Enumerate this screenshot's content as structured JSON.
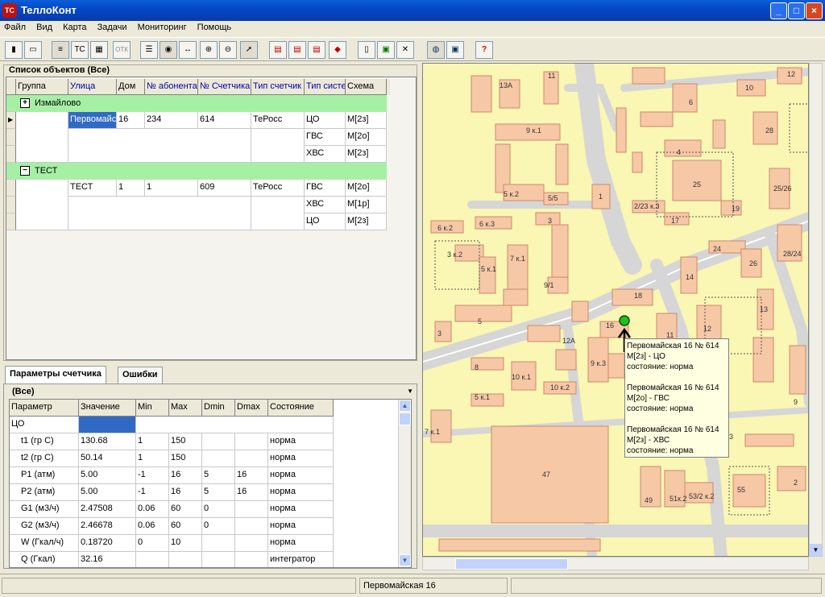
{
  "window": {
    "title": "ТеллоКонт",
    "icon_text": "TC"
  },
  "menu": [
    "Файл",
    "Вид",
    "Карта",
    "Задачи",
    "Мониторинг",
    "Помощь"
  ],
  "toolbar": {
    "otk_label": "ОТК",
    "help_label": "?"
  },
  "objects": {
    "title": "Список объектов (Все)",
    "columns": [
      "Группа",
      "Улица",
      "Дом",
      "№ абонента",
      "№ Счетчика",
      "Тип счетчик",
      "Тип систе",
      "Схема"
    ],
    "group1": {
      "name": "Измайлово",
      "expander": "+"
    },
    "group2": {
      "name": "ТЕСТ",
      "expander": "−"
    },
    "rows": [
      {
        "street": "Первомайская",
        "house": "16",
        "abonent": "234",
        "meter": "614",
        "meter_type": "ТеРосс",
        "system": "ЦО",
        "scheme": "М[2з]"
      },
      {
        "system": "ГВС",
        "scheme": "М[2о]"
      },
      {
        "system": "ХВС",
        "scheme": "М[2з]"
      },
      {
        "street": "ТЕСТ",
        "house": "1",
        "abonent": "1",
        "meter": "609",
        "meter_type": "ТеРосс",
        "system": "ГВС",
        "scheme": "М[2о]"
      },
      {
        "system": "ХВС",
        "scheme": "М[1р]"
      },
      {
        "system": "ЦО",
        "scheme": "М[2з]"
      }
    ]
  },
  "tabs": [
    "Параметры счетчика",
    "Ошибки"
  ],
  "params": {
    "title": "(Все)",
    "columns": [
      "Параметр",
      "Значение",
      "Min",
      "Max",
      "Dmin",
      "Dmax",
      "Состояние"
    ],
    "section": "ЦО",
    "rows": [
      [
        "t1   (гр С)",
        "130.68",
        "1",
        "150",
        "",
        "",
        "норма"
      ],
      [
        "t2   (гр С)",
        "50.14",
        "1",
        "150",
        "",
        "",
        "норма"
      ],
      [
        "P1 (атм)",
        "5.00",
        "-1",
        "16",
        "5",
        "16",
        "норма"
      ],
      [
        "P2 (атм)",
        "5.00",
        "-1",
        "16",
        "5",
        "16",
        "норма"
      ],
      [
        "G1 (м3/ч)",
        "2.47508",
        "0.06",
        "60",
        "0",
        "",
        "норма"
      ],
      [
        "G2 (м3/ч)",
        "2.46678",
        "0.06",
        "60",
        "0",
        "",
        "норма"
      ],
      [
        "W  (Гкал/ч)",
        "0.18720",
        "0",
        "10",
        "",
        "",
        "норма"
      ],
      [
        "Q  (Гкал)",
        "32.16",
        "",
        "",
        "",
        "",
        "интегратор"
      ]
    ]
  },
  "map": {
    "popup": [
      {
        "line1": "Первомайская 16 № 614",
        "line2": "М[2з] - ЦО",
        "line3": "состояние: норма"
      },
      {
        "line1": "Первомайская 16 № 614",
        "line2": "М[2о] - ГВС",
        "line3": "состояние: норма"
      },
      {
        "line1": "Первомайская 16 № 614",
        "line2": "М[2з] - ХВС",
        "line3": "состояние: норма"
      }
    ],
    "labels": [
      "13А",
      "11",
      "10",
      "12",
      "6",
      "28",
      "9 к.1",
      "4",
      "25",
      "25/26",
      "5 к.2",
      "5/5",
      "1",
      "2/23 к.3",
      "19",
      "17",
      "6 к.2",
      "6 к.3",
      "3",
      "3 к.2",
      "5 к.1",
      "7 к.1",
      "24",
      "26",
      "28/24",
      "14",
      "9/1",
      "18",
      "16",
      "13",
      "12",
      "5",
      "12А",
      "11",
      "3",
      "8",
      "10 к.1",
      "9 к.3",
      "10 к.2",
      "5 к.1",
      "7 к.1",
      "47",
      "49",
      "51к.2",
      "53/2 к.2",
      "55",
      "2",
      "3",
      "9"
    ]
  },
  "status": {
    "text": "Первомайская   16"
  }
}
